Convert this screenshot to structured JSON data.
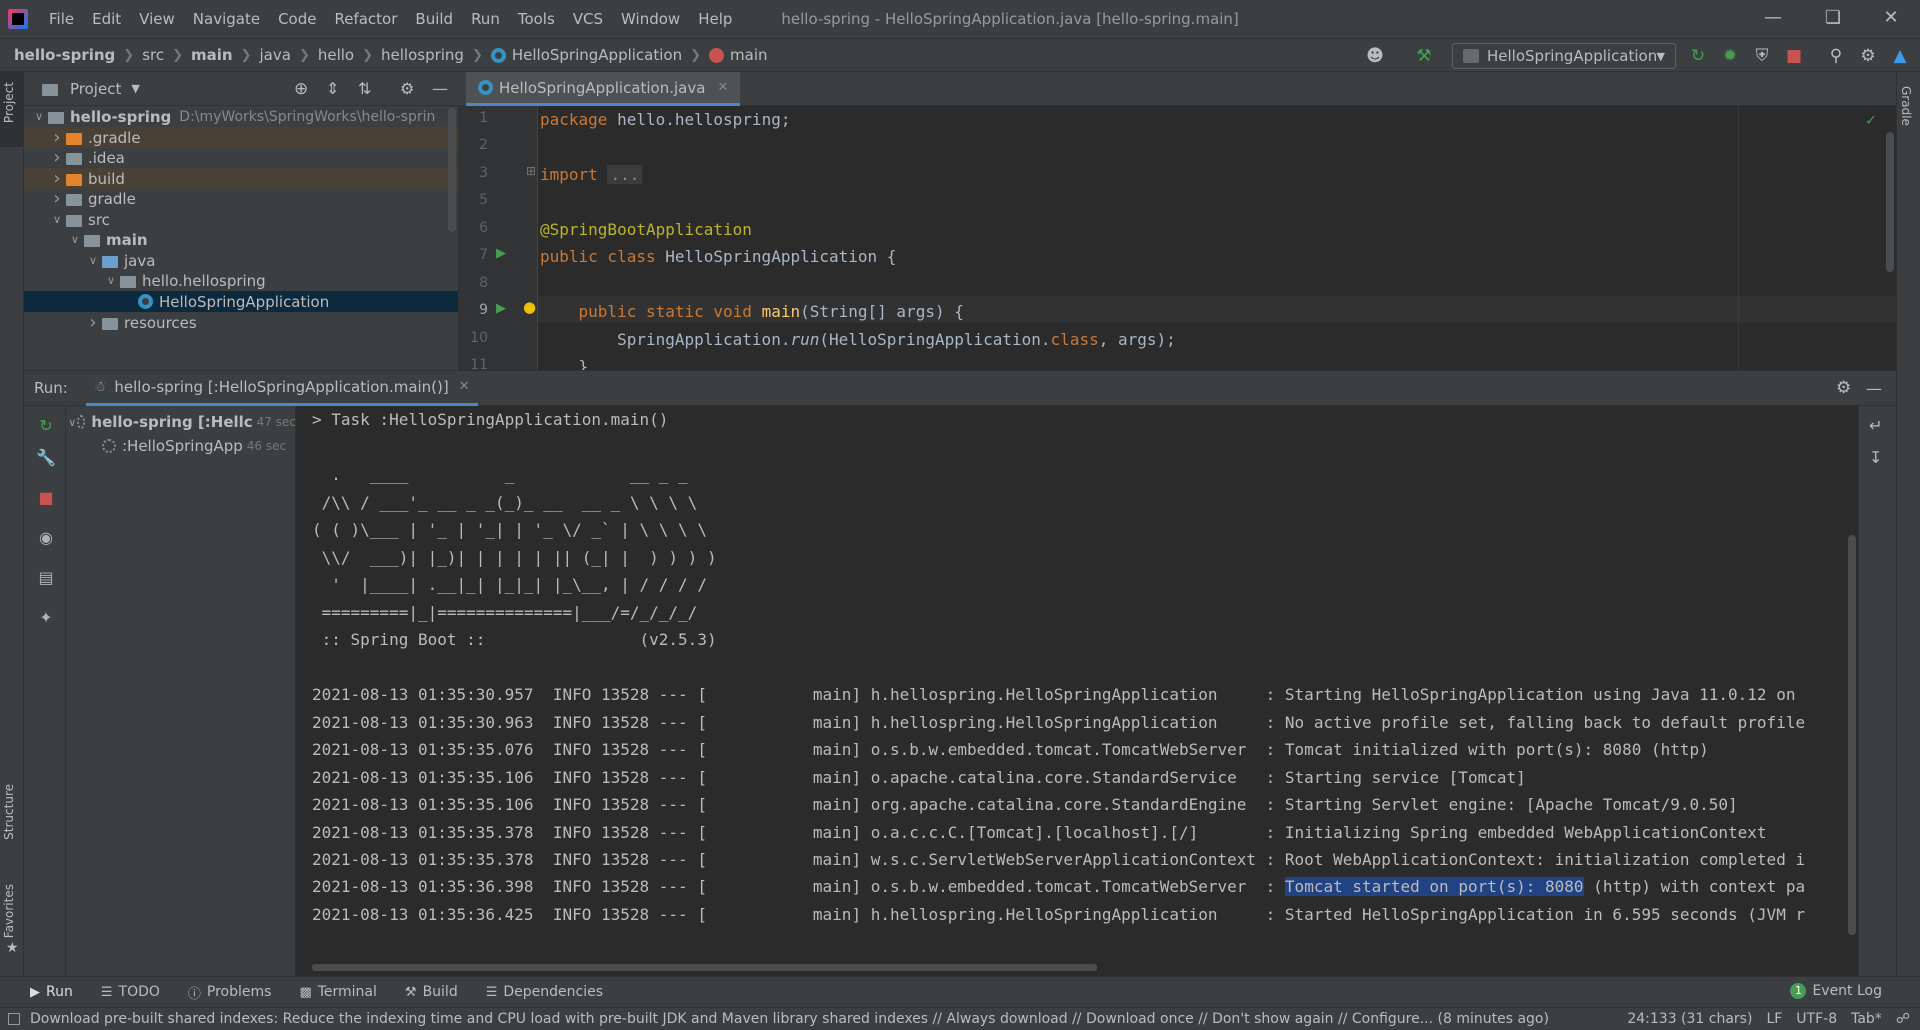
{
  "menu": {
    "items": [
      "File",
      "Edit",
      "View",
      "Navigate",
      "Code",
      "Refactor",
      "Build",
      "Run",
      "Tools",
      "VCS",
      "Window",
      "Help"
    ],
    "window_title": "hello-spring - HelloSpringApplication.java [hello-spring.main]"
  },
  "breadcrumbs": [
    "hello-spring",
    "src",
    "main",
    "java",
    "hello",
    "hellospring",
    "HelloSpringApplication",
    "main"
  ],
  "toolbar": {
    "run_config": "HelloSpringApplication"
  },
  "strips": {
    "project": "Project",
    "structure": "Structure",
    "favorites": "Favorites",
    "gradle": "Gradle"
  },
  "project": {
    "title": "Project",
    "tree": [
      {
        "label": "hello-spring",
        "path": "D:\\myWorks\\SpringWorks\\hello-sprin",
        "depth": 0,
        "chev": "v",
        "icon": "module"
      },
      {
        "label": ".gradle",
        "depth": 1,
        "chev": ">",
        "icon": "orange"
      },
      {
        "label": ".idea",
        "depth": 1,
        "chev": ">",
        "icon": "plain"
      },
      {
        "label": "build",
        "depth": 1,
        "chev": ">",
        "icon": "orange"
      },
      {
        "label": "gradle",
        "depth": 1,
        "chev": ">",
        "icon": "plain"
      },
      {
        "label": "src",
        "depth": 1,
        "chev": "v",
        "icon": "plain"
      },
      {
        "label": "main",
        "depth": 2,
        "chev": "v",
        "icon": "plain"
      },
      {
        "label": "java",
        "depth": 3,
        "chev": "v",
        "icon": "blue"
      },
      {
        "label": "hello.hellospring",
        "depth": 4,
        "chev": "v",
        "icon": "plain"
      },
      {
        "label": "HelloSpringApplication",
        "depth": 5,
        "chev": "",
        "icon": "class"
      },
      {
        "label": "resources",
        "depth": 3,
        "chev": ">",
        "icon": "plain"
      }
    ]
  },
  "editor": {
    "tab": "HelloSpringApplication.java",
    "line_numbers": [
      "1",
      "2",
      "3",
      "5",
      "6",
      "7",
      "8",
      "9",
      "10",
      "11"
    ],
    "lines": {
      "l1_kw": "package",
      "l1_rest": " hello.hellospring;",
      "l3_kw": "import",
      "l3_fold": "...",
      "l6": "@SpringBootApplication",
      "l7_kw": "public class",
      "l7_rest": " HelloSpringApplication {",
      "l9_kw": "public static void",
      "l9_fn": "main",
      "l9_rest": "(String[] args",
      "l9_end": ") {",
      "l10_a": "SpringApplication.",
      "l10_run": "run",
      "l10_b": "(HelloSpringApplication.",
      "l10_cls": "class",
      "l10_c": ", args);",
      "l11": "}"
    }
  },
  "run": {
    "label": "Run:",
    "tab": "hello-spring [:HelloSpringApplication.main()]",
    "tree": [
      {
        "label": "hello-spring [:Hellc",
        "time": "47 sec"
      },
      {
        "label": ":HelloSpringApp",
        "time": "46 sec"
      }
    ],
    "console": [
      "> Task :HelloSpringApplication.main()",
      "",
      "  .   ____          _            __ _ _",
      " /\\\\ / ___'_ __ _ _(_)_ __  __ _ \\ \\ \\ \\",
      "( ( )\\___ | '_ | '_| | '_ \\/ _` | \\ \\ \\ \\",
      " \\\\/  ___)| |_)| | | | | || (_| |  ) ) ) )",
      "  '  |____| .__|_| |_|_| |_\\__, | / / / /",
      " =========|_|==============|___/=/_/_/_/",
      " :: Spring Boot ::                (v2.5.3)",
      "",
      "2021-08-13 01:35:30.957  INFO 13528 --- [           main] h.hellospring.HelloSpringApplication     : Starting HelloSpringApplication using Java 11.0.12 on",
      "2021-08-13 01:35:30.963  INFO 13528 --- [           main] h.hellospring.HelloSpringApplication     : No active profile set, falling back to default profile",
      "2021-08-13 01:35:35.076  INFO 13528 --- [           main] o.s.b.w.embedded.tomcat.TomcatWebServer  : Tomcat initialized with port(s): 8080 (http)",
      "2021-08-13 01:35:35.106  INFO 13528 --- [           main] o.apache.catalina.core.StandardService   : Starting service [Tomcat]",
      "2021-08-13 01:35:35.106  INFO 13528 --- [           main] org.apache.catalina.core.StandardEngine  : Starting Servlet engine: [Apache Tomcat/9.0.50]",
      "2021-08-13 01:35:35.378  INFO 13528 --- [           main] o.a.c.c.C.[Tomcat].[localhost].[/]       : Initializing Spring embedded WebApplicationContext",
      "2021-08-13 01:35:35.378  INFO 13528 --- [           main] w.s.c.ServletWebServerApplicationContext : Root WebApplicationContext: initialization completed i"
    ],
    "hl_prefix": "2021-08-13 01:35:36.398  INFO 13528 --- [           main] o.s.b.w.embedded.tomcat.TomcatWebServer  : ",
    "hl_text": "Tomcat started on port(s): 8080",
    "hl_suffix": " (http) with context pa",
    "last_line": "2021-08-13 01:35:36.425  INFO 13528 --- [           main] h.hellospring.HelloSpringApplication     : Started HelloSpringApplication in 6.595 seconds (JVM r"
  },
  "bottom_tabs": [
    "Run",
    "TODO",
    "Problems",
    "Terminal",
    "Build",
    "Dependencies"
  ],
  "event_log": {
    "label": "Event Log",
    "count": "1"
  },
  "status": {
    "message": "Download pre-built shared indexes: Reduce the indexing time and CPU load with pre-built JDK and Maven library shared indexes // Always download // Download once // Don't show again // Configure... (8 minutes ago)",
    "position": "24:133 (31 chars)",
    "line_sep": "LF",
    "encoding": "UTF-8",
    "indent": "Tab*"
  }
}
